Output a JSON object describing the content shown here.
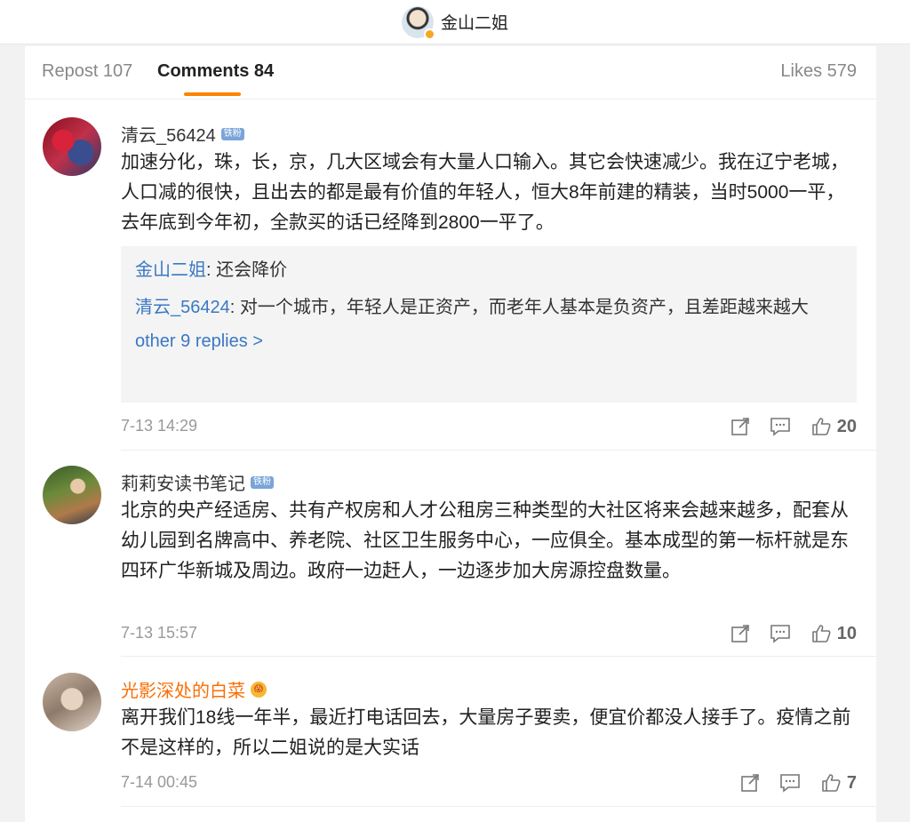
{
  "header": {
    "title": "金山二姐"
  },
  "tabs": {
    "repost": "Repost 107",
    "comments": "Comments 84",
    "likes": "Likes 579"
  },
  "colors": {
    "accent": "#ff8200",
    "link": "#3a78c3",
    "vip_name": "#f86f08"
  },
  "comments": [
    {
      "user": "清云_56424",
      "badge": "铁粉",
      "text": "加速分化，珠，长，京，几大区域会有大量人口输入。其它会快速减少。我在辽宁老城，人口减的很快，且出去的都是最有价值的年轻人，恒大8年前建的精装，当时5000一平，去年底到今年初，全款买的话已经降到2800一平了。",
      "replies": [
        {
          "user": "金山二姐",
          "sep": ": ",
          "text": "还会降价"
        },
        {
          "user": "清云_56424",
          "sep": ": ",
          "text": "对一个城市，年轻人是正资产，而老年人基本是负资产，且差距越来越大"
        }
      ],
      "more_replies": "other 9 replies >",
      "time": "7-13 14:29",
      "likes": "20",
      "icons": [
        "share-icon",
        "comment-icon",
        "like-icon"
      ]
    },
    {
      "user": "莉莉安读书笔记",
      "badge": "铁粉",
      "text": "北京的央产经适房、共有产权房和人才公租房三种类型的大社区将来会越来越多，配套从幼儿园到名牌高中、养老院、社区卫生服务中心，一应俱全。基本成型的第一标杆就是东四环广华新城及周边。政府一边赶人，一边逐步加大房源控盘数量。",
      "time": "7-13 15:57",
      "likes": "10",
      "icons": [
        "share-icon",
        "comment-icon",
        "like-icon"
      ]
    },
    {
      "user": "光影深处的白菜",
      "text": "离开我们18线一年半，最近打电话回去，大量房子要卖，便宜价都没人接手了。疫情之前不是这样的，所以二姐说的是大实话",
      "time": "7-14 00:45",
      "likes": "7",
      "icons": [
        "share-icon",
        "comment-icon",
        "like-icon"
      ]
    }
  ]
}
